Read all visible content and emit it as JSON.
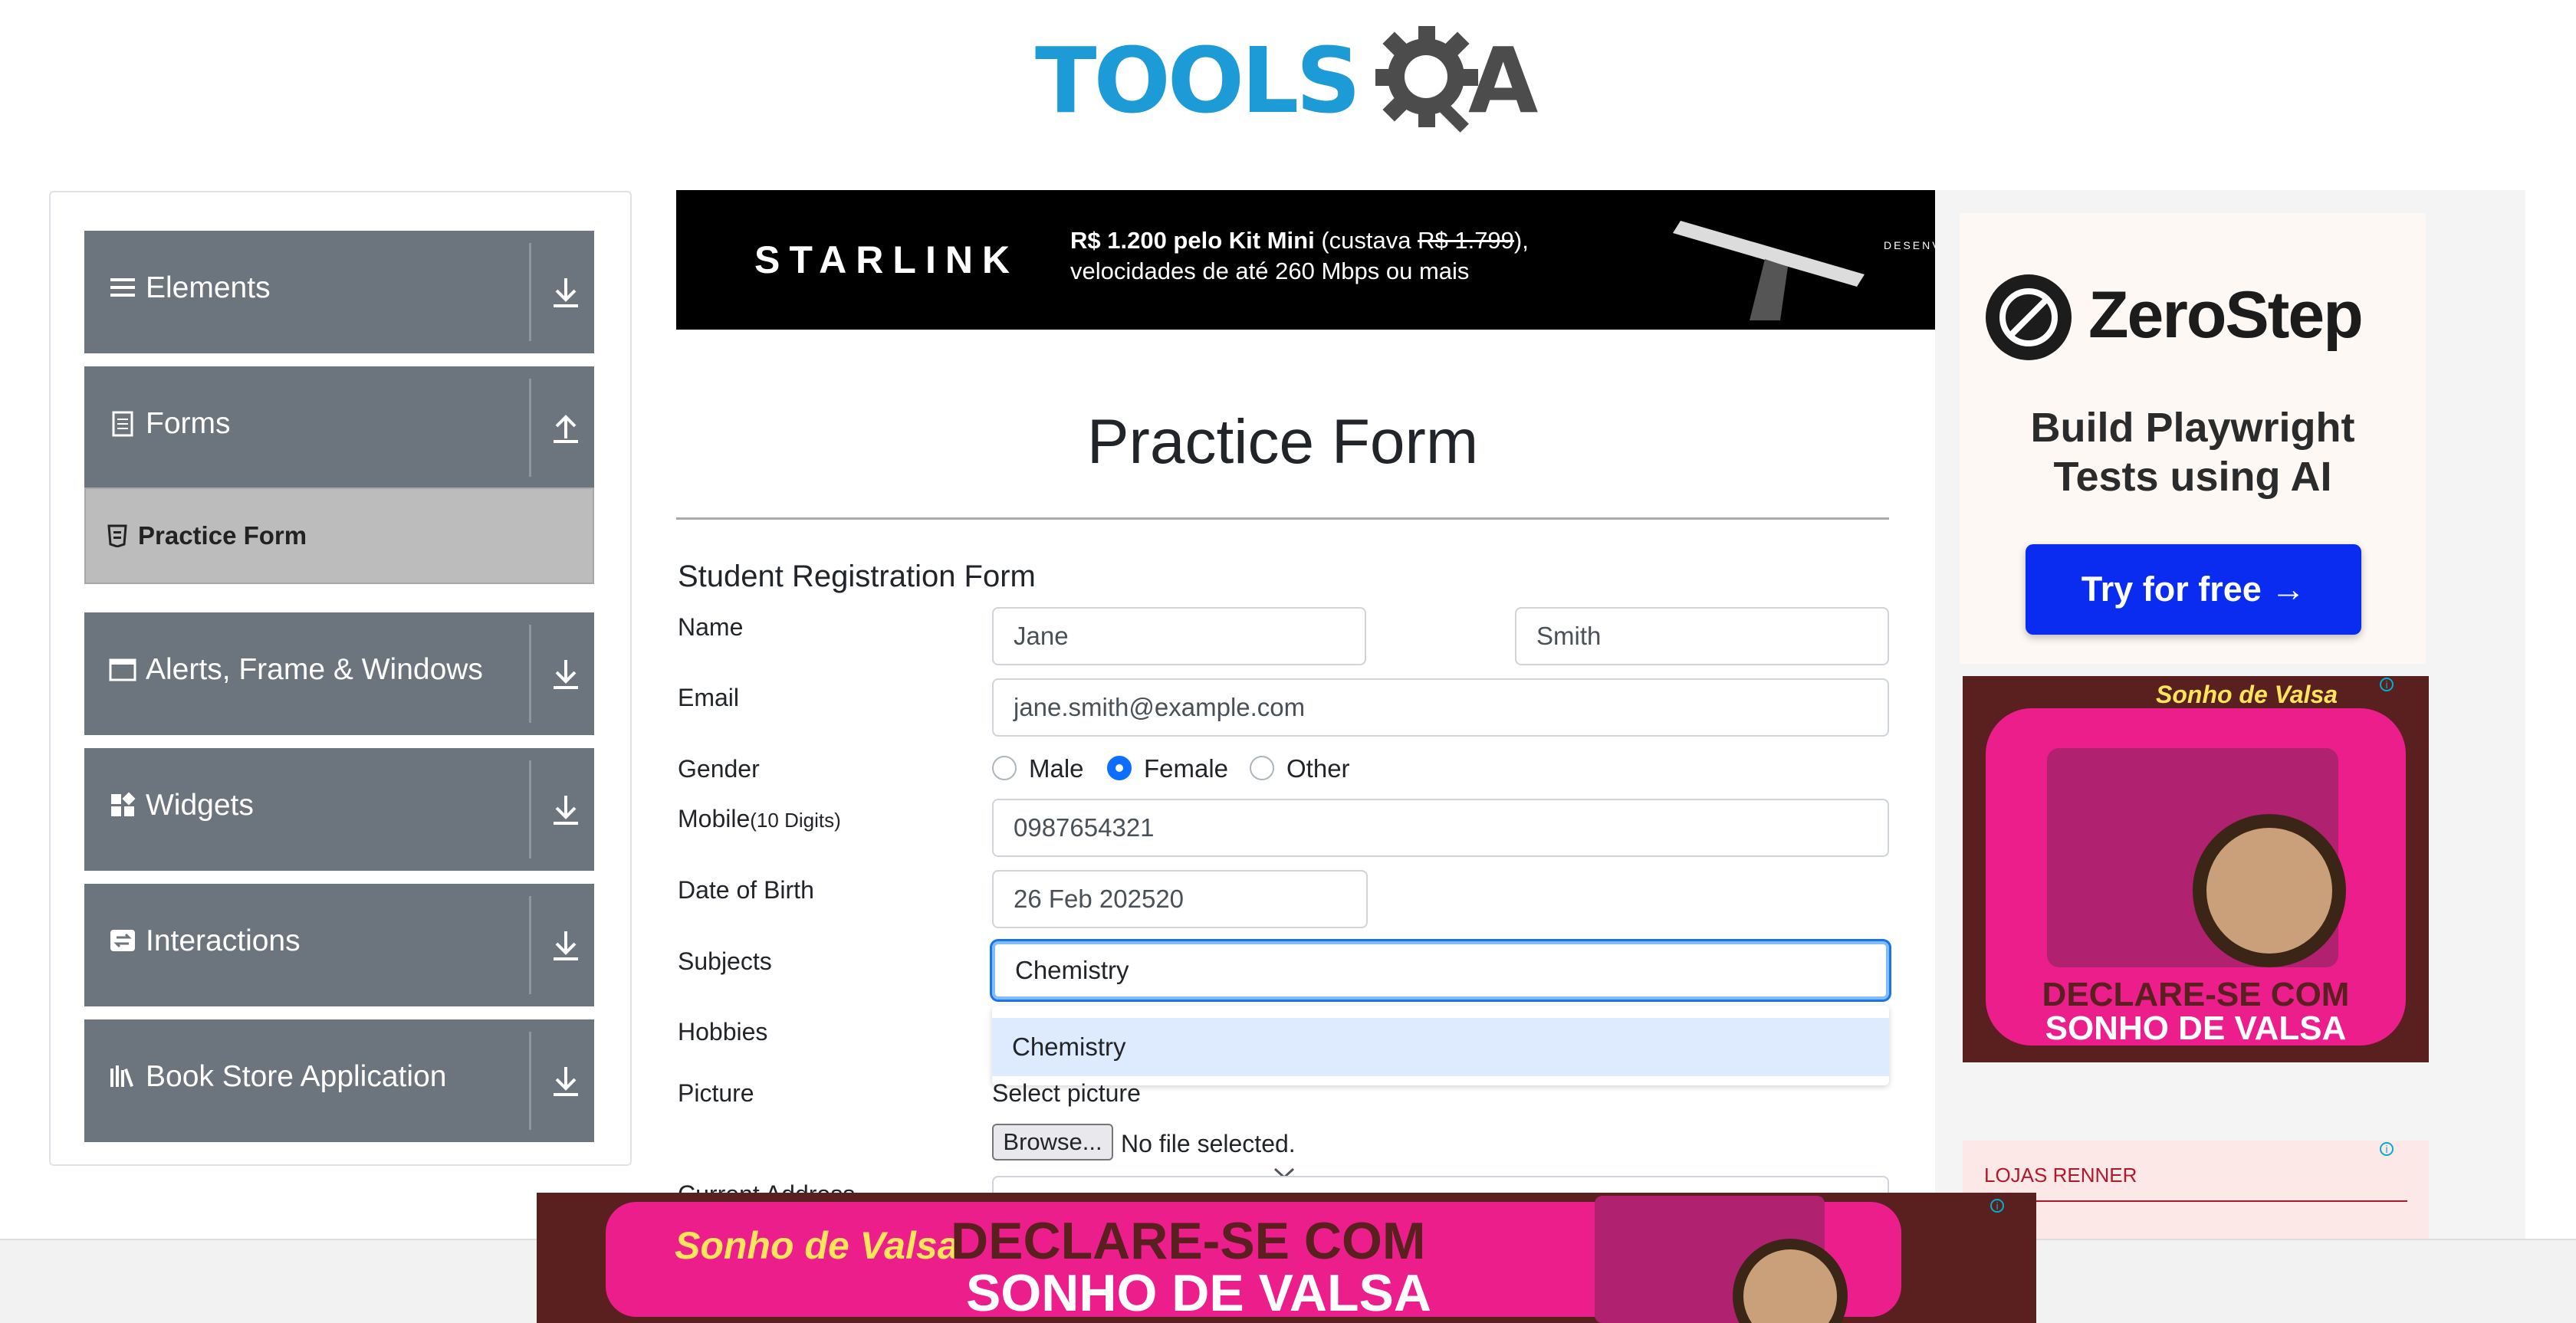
{
  "header": {
    "logo_main": "TOOLS",
    "logo_tail": "A"
  },
  "sidebar": {
    "groups": [
      {
        "label": "Elements",
        "icon": "hamburger-icon"
      },
      {
        "label": "Forms",
        "icon": "document-icon",
        "expanded": true
      },
      {
        "label": "Alerts, Frame & Windows",
        "icon": "window-icon"
      },
      {
        "label": "Widgets",
        "icon": "widgets-icon"
      },
      {
        "label": "Interactions",
        "icon": "interactions-icon"
      },
      {
        "label": "Book Store Application",
        "icon": "books-icon"
      }
    ],
    "active_item": "Practice Form"
  },
  "top_ad": {
    "brand": "STARLINK",
    "line1_bold": "R$ 1.200 pelo Kit Mini",
    "line1_rest": " (custava ",
    "line1_strike": "R$ 1.799",
    "line1_end": "),",
    "line2": "velocidades de até 260 Mbps ou mais",
    "side": "DESENV"
  },
  "form": {
    "title": "Practice Form",
    "subtitle": "Student Registration Form",
    "name_label": "Name",
    "first_name": "Jane",
    "last_name": "Smith",
    "email_label": "Email",
    "email": "jane.smith@example.com",
    "gender_label": "Gender",
    "gender_options": [
      "Male",
      "Female",
      "Other"
    ],
    "gender_selected": "Female",
    "mobile_label": "Mobile",
    "mobile_hint": "(10 Digits)",
    "mobile": "0987654321",
    "dob_label": "Date of Birth",
    "dob": "26 Feb 202520",
    "subjects_label": "Subjects",
    "subjects_value": "Chemistry",
    "subjects_suggestion": "Chemistry",
    "hobbies_label": "Hobbies",
    "picture_label": "Picture",
    "select_picture": "Select picture",
    "browse": "Browse...",
    "no_file": "No file selected.",
    "address_label": "Current Address"
  },
  "right_ads": {
    "zerostep_name": "ZeroStep",
    "zerostep_tag1": "Build Playwright",
    "zerostep_tag2": "Tests using AI",
    "zerostep_cta": "Try for free →",
    "candy_brand": "Sonho de Valsa",
    "candy_line1": "DECLARE-SE COM",
    "candy_line2": "SONHO DE VALSA",
    "renner": "LOJAS RENNER"
  },
  "bottom_ad": {
    "brand": "Sonho de Valsa",
    "line1": "DECLARE-SE COM",
    "line2": "SONHO DE VALSA"
  },
  "colors": {
    "sidebar_group": "#6c757d",
    "accent": "#1d9bd7",
    "focus": "#80bdff",
    "selected": "#0d6efd"
  }
}
